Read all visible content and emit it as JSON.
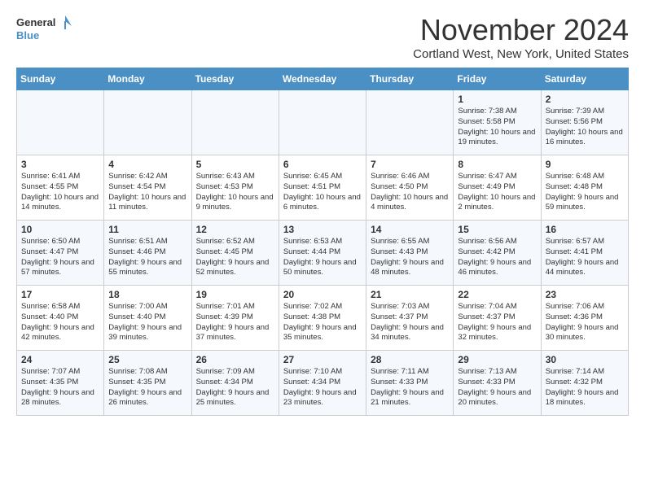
{
  "logo": {
    "line1": "General",
    "line2": "Blue"
  },
  "title": "November 2024",
  "location": "Cortland West, New York, United States",
  "days_of_week": [
    "Sunday",
    "Monday",
    "Tuesday",
    "Wednesday",
    "Thursday",
    "Friday",
    "Saturday"
  ],
  "weeks": [
    [
      {
        "day": "",
        "info": ""
      },
      {
        "day": "",
        "info": ""
      },
      {
        "day": "",
        "info": ""
      },
      {
        "day": "",
        "info": ""
      },
      {
        "day": "",
        "info": ""
      },
      {
        "day": "1",
        "info": "Sunrise: 7:38 AM\nSunset: 5:58 PM\nDaylight: 10 hours and 19 minutes."
      },
      {
        "day": "2",
        "info": "Sunrise: 7:39 AM\nSunset: 5:56 PM\nDaylight: 10 hours and 16 minutes."
      }
    ],
    [
      {
        "day": "3",
        "info": "Sunrise: 6:41 AM\nSunset: 4:55 PM\nDaylight: 10 hours and 14 minutes."
      },
      {
        "day": "4",
        "info": "Sunrise: 6:42 AM\nSunset: 4:54 PM\nDaylight: 10 hours and 11 minutes."
      },
      {
        "day": "5",
        "info": "Sunrise: 6:43 AM\nSunset: 4:53 PM\nDaylight: 10 hours and 9 minutes."
      },
      {
        "day": "6",
        "info": "Sunrise: 6:45 AM\nSunset: 4:51 PM\nDaylight: 10 hours and 6 minutes."
      },
      {
        "day": "7",
        "info": "Sunrise: 6:46 AM\nSunset: 4:50 PM\nDaylight: 10 hours and 4 minutes."
      },
      {
        "day": "8",
        "info": "Sunrise: 6:47 AM\nSunset: 4:49 PM\nDaylight: 10 hours and 2 minutes."
      },
      {
        "day": "9",
        "info": "Sunrise: 6:48 AM\nSunset: 4:48 PM\nDaylight: 9 hours and 59 minutes."
      }
    ],
    [
      {
        "day": "10",
        "info": "Sunrise: 6:50 AM\nSunset: 4:47 PM\nDaylight: 9 hours and 57 minutes."
      },
      {
        "day": "11",
        "info": "Sunrise: 6:51 AM\nSunset: 4:46 PM\nDaylight: 9 hours and 55 minutes."
      },
      {
        "day": "12",
        "info": "Sunrise: 6:52 AM\nSunset: 4:45 PM\nDaylight: 9 hours and 52 minutes."
      },
      {
        "day": "13",
        "info": "Sunrise: 6:53 AM\nSunset: 4:44 PM\nDaylight: 9 hours and 50 minutes."
      },
      {
        "day": "14",
        "info": "Sunrise: 6:55 AM\nSunset: 4:43 PM\nDaylight: 9 hours and 48 minutes."
      },
      {
        "day": "15",
        "info": "Sunrise: 6:56 AM\nSunset: 4:42 PM\nDaylight: 9 hours and 46 minutes."
      },
      {
        "day": "16",
        "info": "Sunrise: 6:57 AM\nSunset: 4:41 PM\nDaylight: 9 hours and 44 minutes."
      }
    ],
    [
      {
        "day": "17",
        "info": "Sunrise: 6:58 AM\nSunset: 4:40 PM\nDaylight: 9 hours and 42 minutes."
      },
      {
        "day": "18",
        "info": "Sunrise: 7:00 AM\nSunset: 4:40 PM\nDaylight: 9 hours and 39 minutes."
      },
      {
        "day": "19",
        "info": "Sunrise: 7:01 AM\nSunset: 4:39 PM\nDaylight: 9 hours and 37 minutes."
      },
      {
        "day": "20",
        "info": "Sunrise: 7:02 AM\nSunset: 4:38 PM\nDaylight: 9 hours and 35 minutes."
      },
      {
        "day": "21",
        "info": "Sunrise: 7:03 AM\nSunset: 4:37 PM\nDaylight: 9 hours and 34 minutes."
      },
      {
        "day": "22",
        "info": "Sunrise: 7:04 AM\nSunset: 4:37 PM\nDaylight: 9 hours and 32 minutes."
      },
      {
        "day": "23",
        "info": "Sunrise: 7:06 AM\nSunset: 4:36 PM\nDaylight: 9 hours and 30 minutes."
      }
    ],
    [
      {
        "day": "24",
        "info": "Sunrise: 7:07 AM\nSunset: 4:35 PM\nDaylight: 9 hours and 28 minutes."
      },
      {
        "day": "25",
        "info": "Sunrise: 7:08 AM\nSunset: 4:35 PM\nDaylight: 9 hours and 26 minutes."
      },
      {
        "day": "26",
        "info": "Sunrise: 7:09 AM\nSunset: 4:34 PM\nDaylight: 9 hours and 25 minutes."
      },
      {
        "day": "27",
        "info": "Sunrise: 7:10 AM\nSunset: 4:34 PM\nDaylight: 9 hours and 23 minutes."
      },
      {
        "day": "28",
        "info": "Sunrise: 7:11 AM\nSunset: 4:33 PM\nDaylight: 9 hours and 21 minutes."
      },
      {
        "day": "29",
        "info": "Sunrise: 7:13 AM\nSunset: 4:33 PM\nDaylight: 9 hours and 20 minutes."
      },
      {
        "day": "30",
        "info": "Sunrise: 7:14 AM\nSunset: 4:32 PM\nDaylight: 9 hours and 18 minutes."
      }
    ]
  ]
}
